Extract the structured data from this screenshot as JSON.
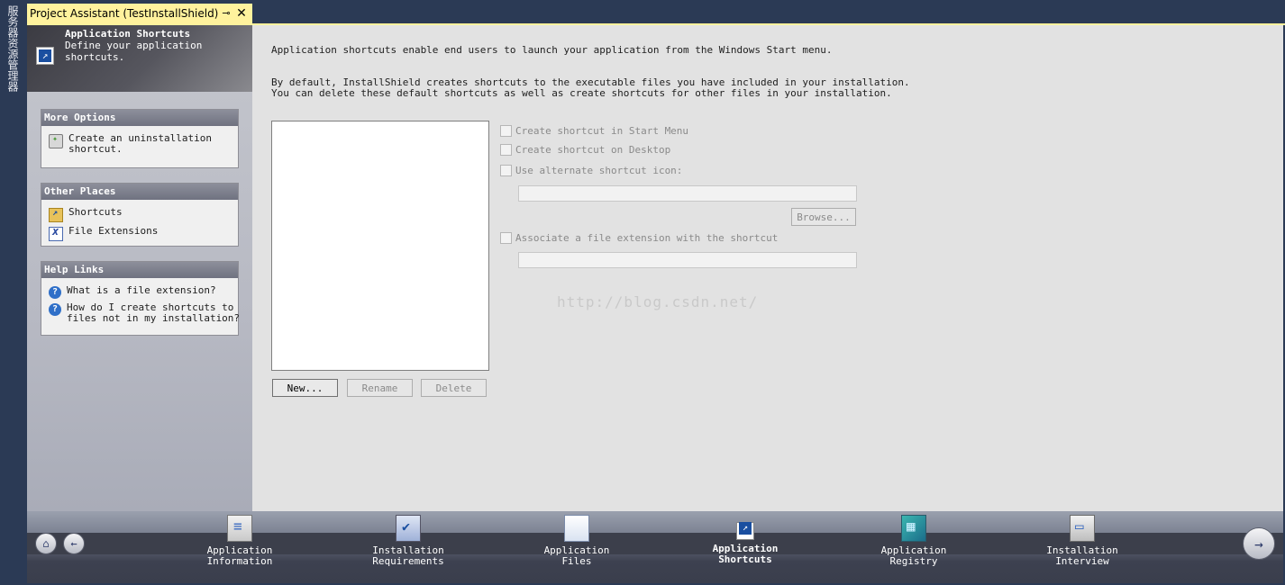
{
  "side_rail": {
    "label": "服务器资源管理器"
  },
  "tab": {
    "title": "Project Assistant (TestInstallShield)",
    "pin_glyph": "⊸",
    "close_glyph": "✕"
  },
  "banner": {
    "title": "Application Shortcuts",
    "subtitle": "Define your application shortcuts."
  },
  "more_options": {
    "header": "More Options",
    "items": [
      {
        "label": "Create an uninstallation\nshortcut."
      }
    ]
  },
  "other_places": {
    "header": "Other Places",
    "items": [
      {
        "label": "Shortcuts"
      },
      {
        "label": "File Extensions"
      }
    ]
  },
  "help_links": {
    "header": "Help Links",
    "items": [
      {
        "label": "What is a file extension?"
      },
      {
        "label": "How do I create shortcuts to\nfiles not in my installation?"
      }
    ]
  },
  "main": {
    "intro": "Application shortcuts enable end users to launch your application from the Windows Start menu.",
    "default_text": "By default, InstallShield creates shortcuts to the executable files you have included in your installation.\nYou can delete these default shortcuts as well as create shortcuts for other files in your installation.",
    "buttons": {
      "new": "New...",
      "rename": "Rename",
      "delete": "Delete",
      "browse": "Browse..."
    },
    "options": {
      "start_menu": "Create shortcut in Start Menu",
      "desktop": "Create shortcut on Desktop",
      "alt_icon": "Use alternate shortcut icon:",
      "file_ext": "Associate a file extension with the shortcut"
    },
    "watermark": "http://blog.csdn.net/"
  },
  "nav": {
    "home_glyph": "⌂",
    "back_glyph": "←",
    "next_glyph": "→",
    "steps": [
      {
        "label": "Application\nInformation"
      },
      {
        "label": "Installation\nRequirements"
      },
      {
        "label": "Application\nFiles"
      },
      {
        "label": "Application\nShortcuts"
      },
      {
        "label": "Application\nRegistry"
      },
      {
        "label": "Installation\nInterview"
      }
    ]
  }
}
